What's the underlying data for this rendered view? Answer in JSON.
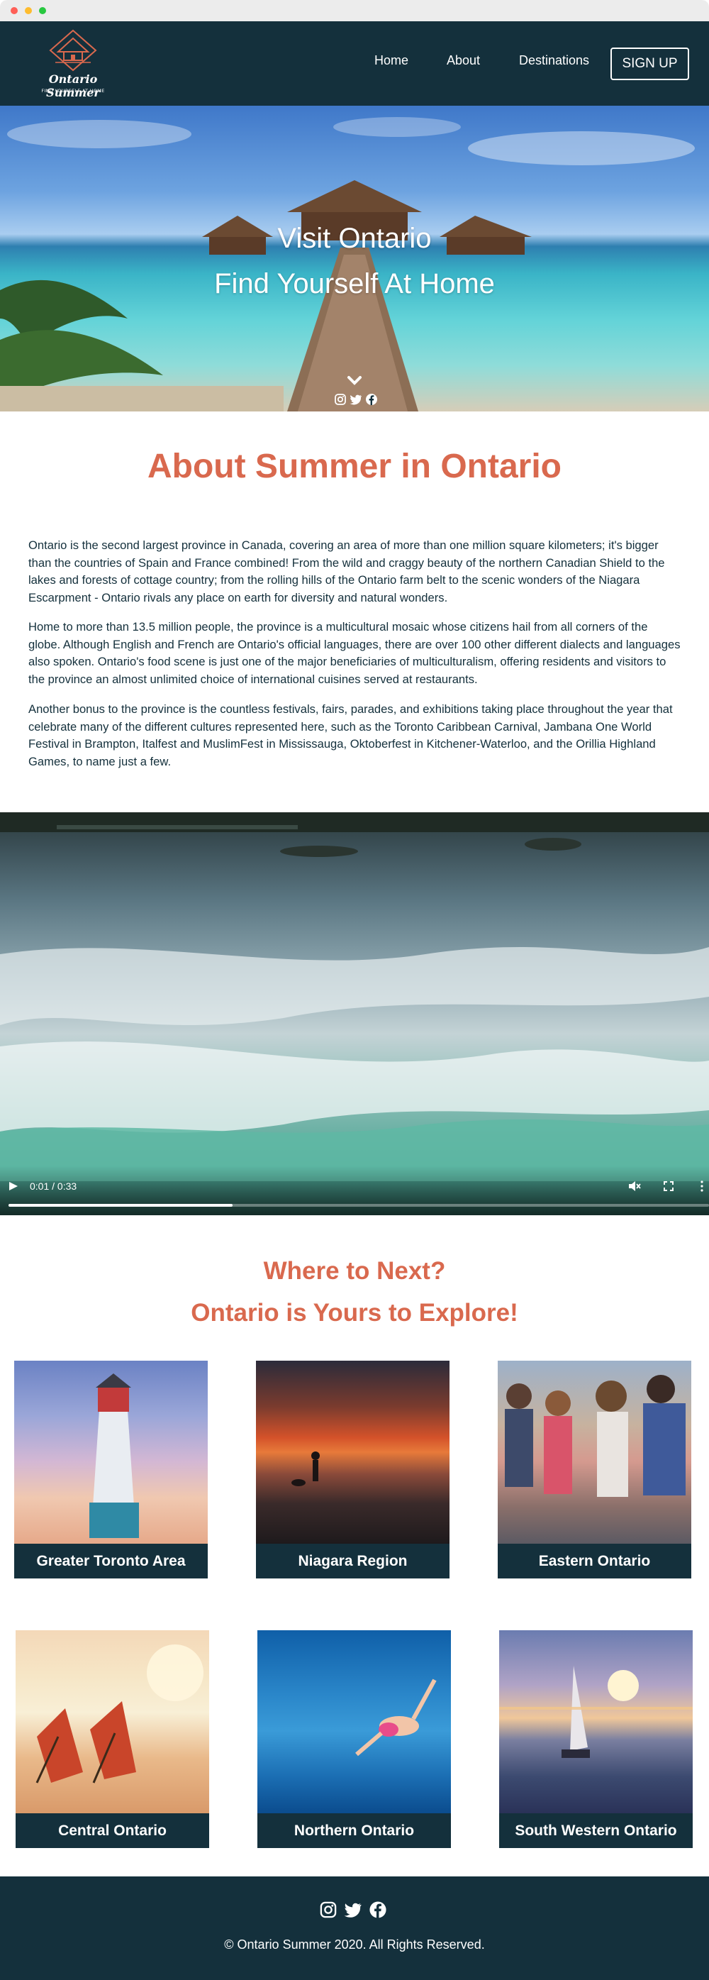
{
  "nav": {
    "logo_title": "Ontario Summer",
    "logo_tagline": "FIND YOURSELF AT HOME",
    "links": [
      "Home",
      "About",
      "Destinations"
    ],
    "signup_label": "SIGN UP"
  },
  "hero": {
    "title": "Visit Ontario",
    "subtitle": "Find Yourself At Home",
    "scroll_icon": "chevron-down-icon",
    "social_icons": [
      "instagram-icon",
      "twitter-icon",
      "facebook-icon"
    ]
  },
  "about": {
    "title": "About Summer in Ontario",
    "paragraphs": [
      "Ontario is the second largest province in Canada, covering an area of more than one million square kilometers; it's bigger than the countries of Spain and France combined! From the wild and craggy beauty of the northern Canadian Shield to the lakes and forests of cottage country; from the rolling hills of the Ontario farm belt to the scenic wonders of the Niagara Escarpment - Ontario rivals any place on earth for diversity and natural wonders.",
      "Home to more than 13.5 million people, the province is a multicultural mosaic whose citizens hail from all corners of the globe. Although English and French are Ontario's official languages, there are over 100 other different dialects and languages also spoken. Ontario's food scene is just one of the major beneficiaries of multiculturalism, offering residents and visitors to the province an almost unlimited choice of international cuisines served at restaurants.",
      "Another bonus to the province is the countless festivals, fairs, parades, and exhibitions taking place throughout the year that celebrate many of the different cultures represented here, such as the Toronto Caribbean Carnival, Jambana One World Festival in Brampton, Italfest and MuslimFest in Mississauga, Oktoberfest in Kitchener-Waterloo, and the Orillia Highland Games, to name just a few."
    ]
  },
  "video": {
    "time": "0:01 / 0:33",
    "progress_fraction": 0.32,
    "muted": true
  },
  "destinations": {
    "title_line1": "Where to Next?",
    "title_line2": "Ontario is Yours to Explore!",
    "cards": [
      {
        "label": "Greater Toronto Area"
      },
      {
        "label": "Niagara Region"
      },
      {
        "label": "Eastern Ontario"
      },
      {
        "label": "Central Ontario"
      },
      {
        "label": "Northern Ontario"
      },
      {
        "label": "South Western Ontario"
      }
    ]
  },
  "footer": {
    "social_icons": [
      "instagram-icon",
      "twitter-icon",
      "facebook-icon"
    ],
    "copyright": "© Ontario Summer 2020. All Rights Reserved."
  },
  "colors": {
    "navy": "#14303c",
    "accent": "#d9694e",
    "white": "#ffffff"
  }
}
